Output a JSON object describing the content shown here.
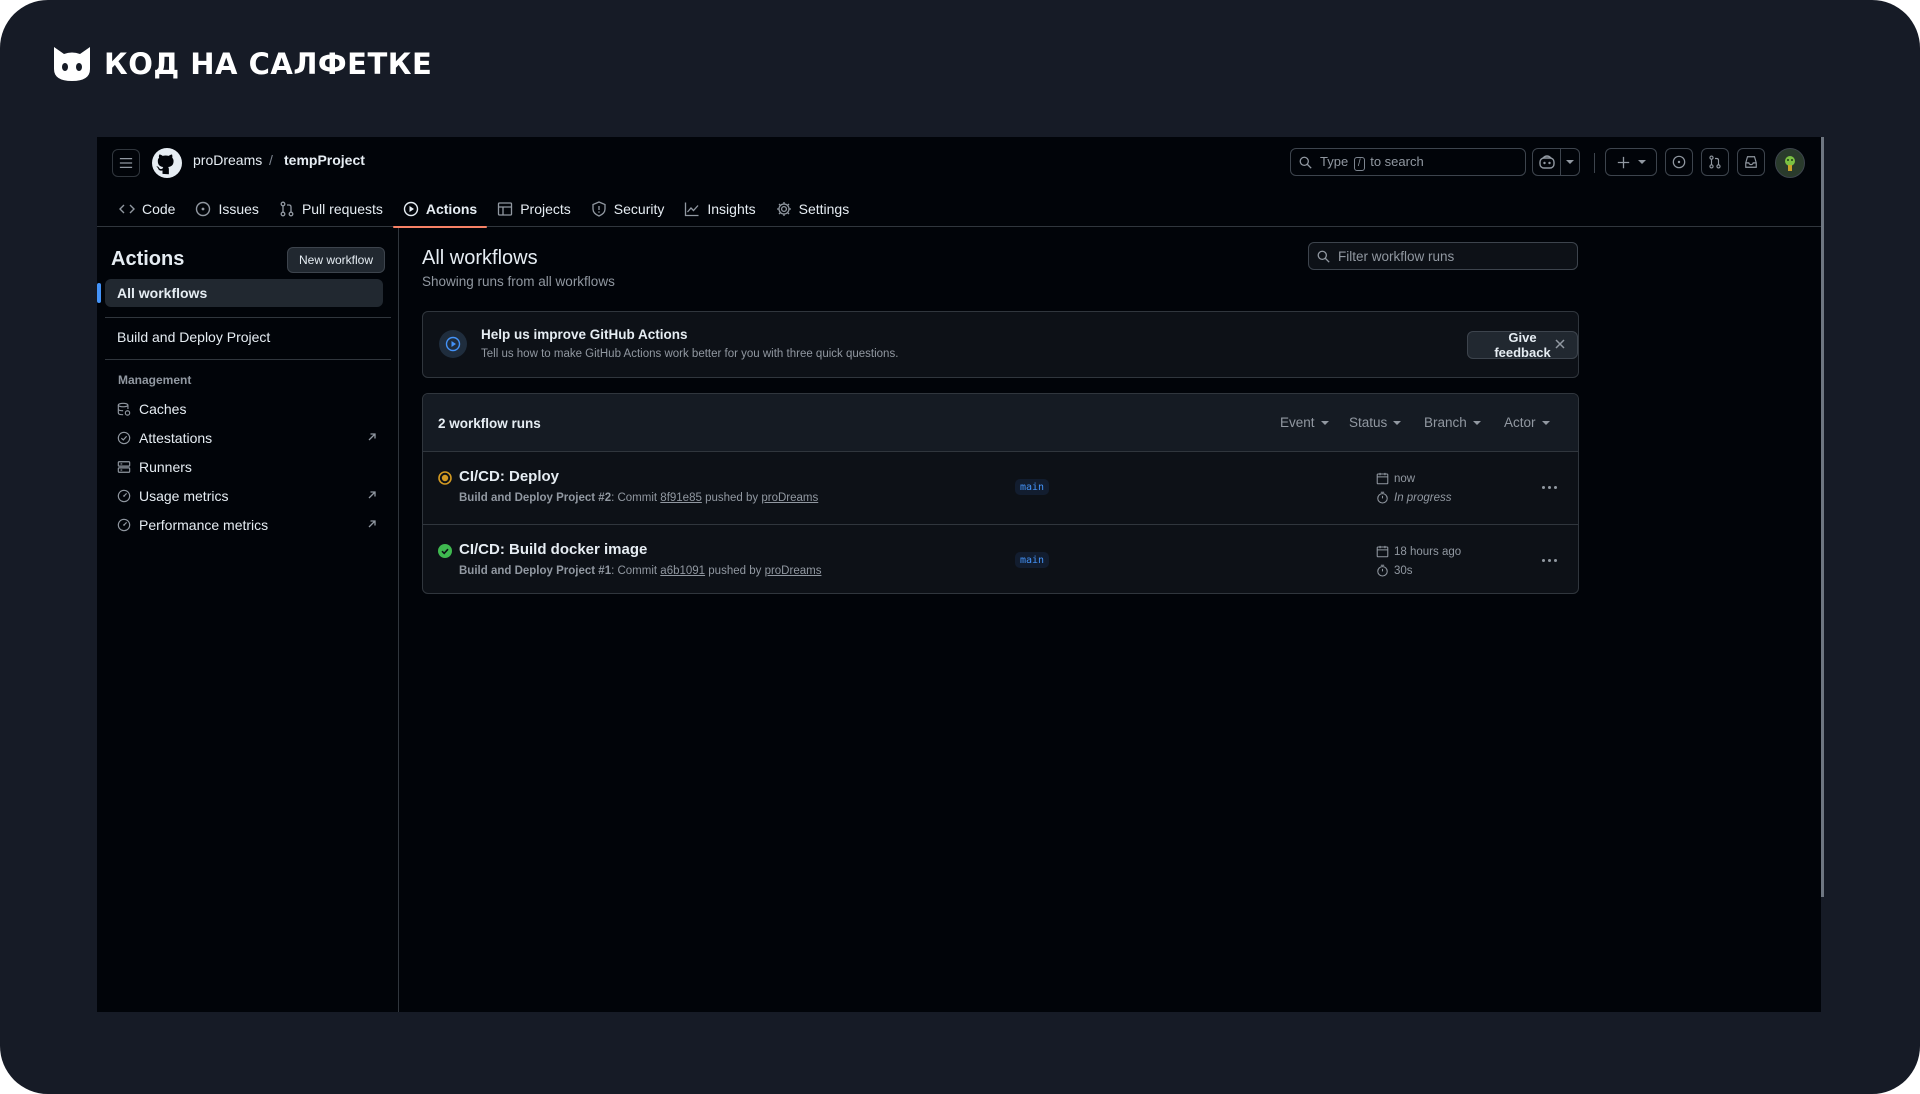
{
  "brand": {
    "name": "КОД НА САЛФЕТКЕ"
  },
  "header": {
    "owner": "proDreams",
    "separator": "/",
    "repo": "tempProject",
    "search": {
      "prefix": "Type",
      "key": "/",
      "suffix": "to search"
    }
  },
  "tabs": [
    {
      "label": "Code",
      "icon": "code-icon"
    },
    {
      "label": "Issues",
      "icon": "issue-icon"
    },
    {
      "label": "Pull requests",
      "icon": "pull-request-icon"
    },
    {
      "label": "Actions",
      "icon": "play-icon",
      "active": true
    },
    {
      "label": "Projects",
      "icon": "table-icon"
    },
    {
      "label": "Security",
      "icon": "shield-icon"
    },
    {
      "label": "Insights",
      "icon": "graph-icon"
    },
    {
      "label": "Settings",
      "icon": "gear-icon"
    }
  ],
  "sidebar": {
    "title": "Actions",
    "new_workflow": "New workflow",
    "all_workflows": "All workflows",
    "workflow": "Build and Deploy Project",
    "section": "Management",
    "items": [
      {
        "label": "Caches",
        "icon": "database-icon",
        "external": false
      },
      {
        "label": "Attestations",
        "icon": "verified-icon",
        "external": true
      },
      {
        "label": "Runners",
        "icon": "server-icon",
        "external": false
      },
      {
        "label": "Usage metrics",
        "icon": "meter-icon",
        "external": true
      },
      {
        "label": "Performance metrics",
        "icon": "meter-icon",
        "external": true
      }
    ]
  },
  "main": {
    "title": "All workflows",
    "subtitle": "Showing runs from all workflows",
    "filter_placeholder": "Filter workflow runs"
  },
  "banner": {
    "title": "Help us improve GitHub Actions",
    "description": "Tell us how to make GitHub Actions work better for you with three quick questions.",
    "button": "Give feedback"
  },
  "runs": {
    "count": "2 workflow runs",
    "filters": [
      "Event",
      "Status",
      "Branch",
      "Actor"
    ],
    "items": [
      {
        "title": "CI/CD: Deploy",
        "status": "in-progress",
        "workflow": "Build and Deploy Project #2",
        "commit_prefix": ": Commit",
        "commit": "8f91e85",
        "pushed_by": "pushed by",
        "user": "proDreams",
        "branch": "main",
        "time": "now",
        "duration": "In progress"
      },
      {
        "title": "CI/CD: Build docker image",
        "status": "success",
        "workflow": "Build and Deploy Project #1",
        "commit_prefix": ": Commit",
        "commit": "a6b1091",
        "pushed_by": "pushed by",
        "user": "proDreams",
        "branch": "main",
        "time": "18 hours ago",
        "duration": "30s"
      }
    ]
  },
  "colors": {
    "accent": "#f78166",
    "link": "#4493f8",
    "success": "#3fb950",
    "in_progress": "#d29922"
  }
}
